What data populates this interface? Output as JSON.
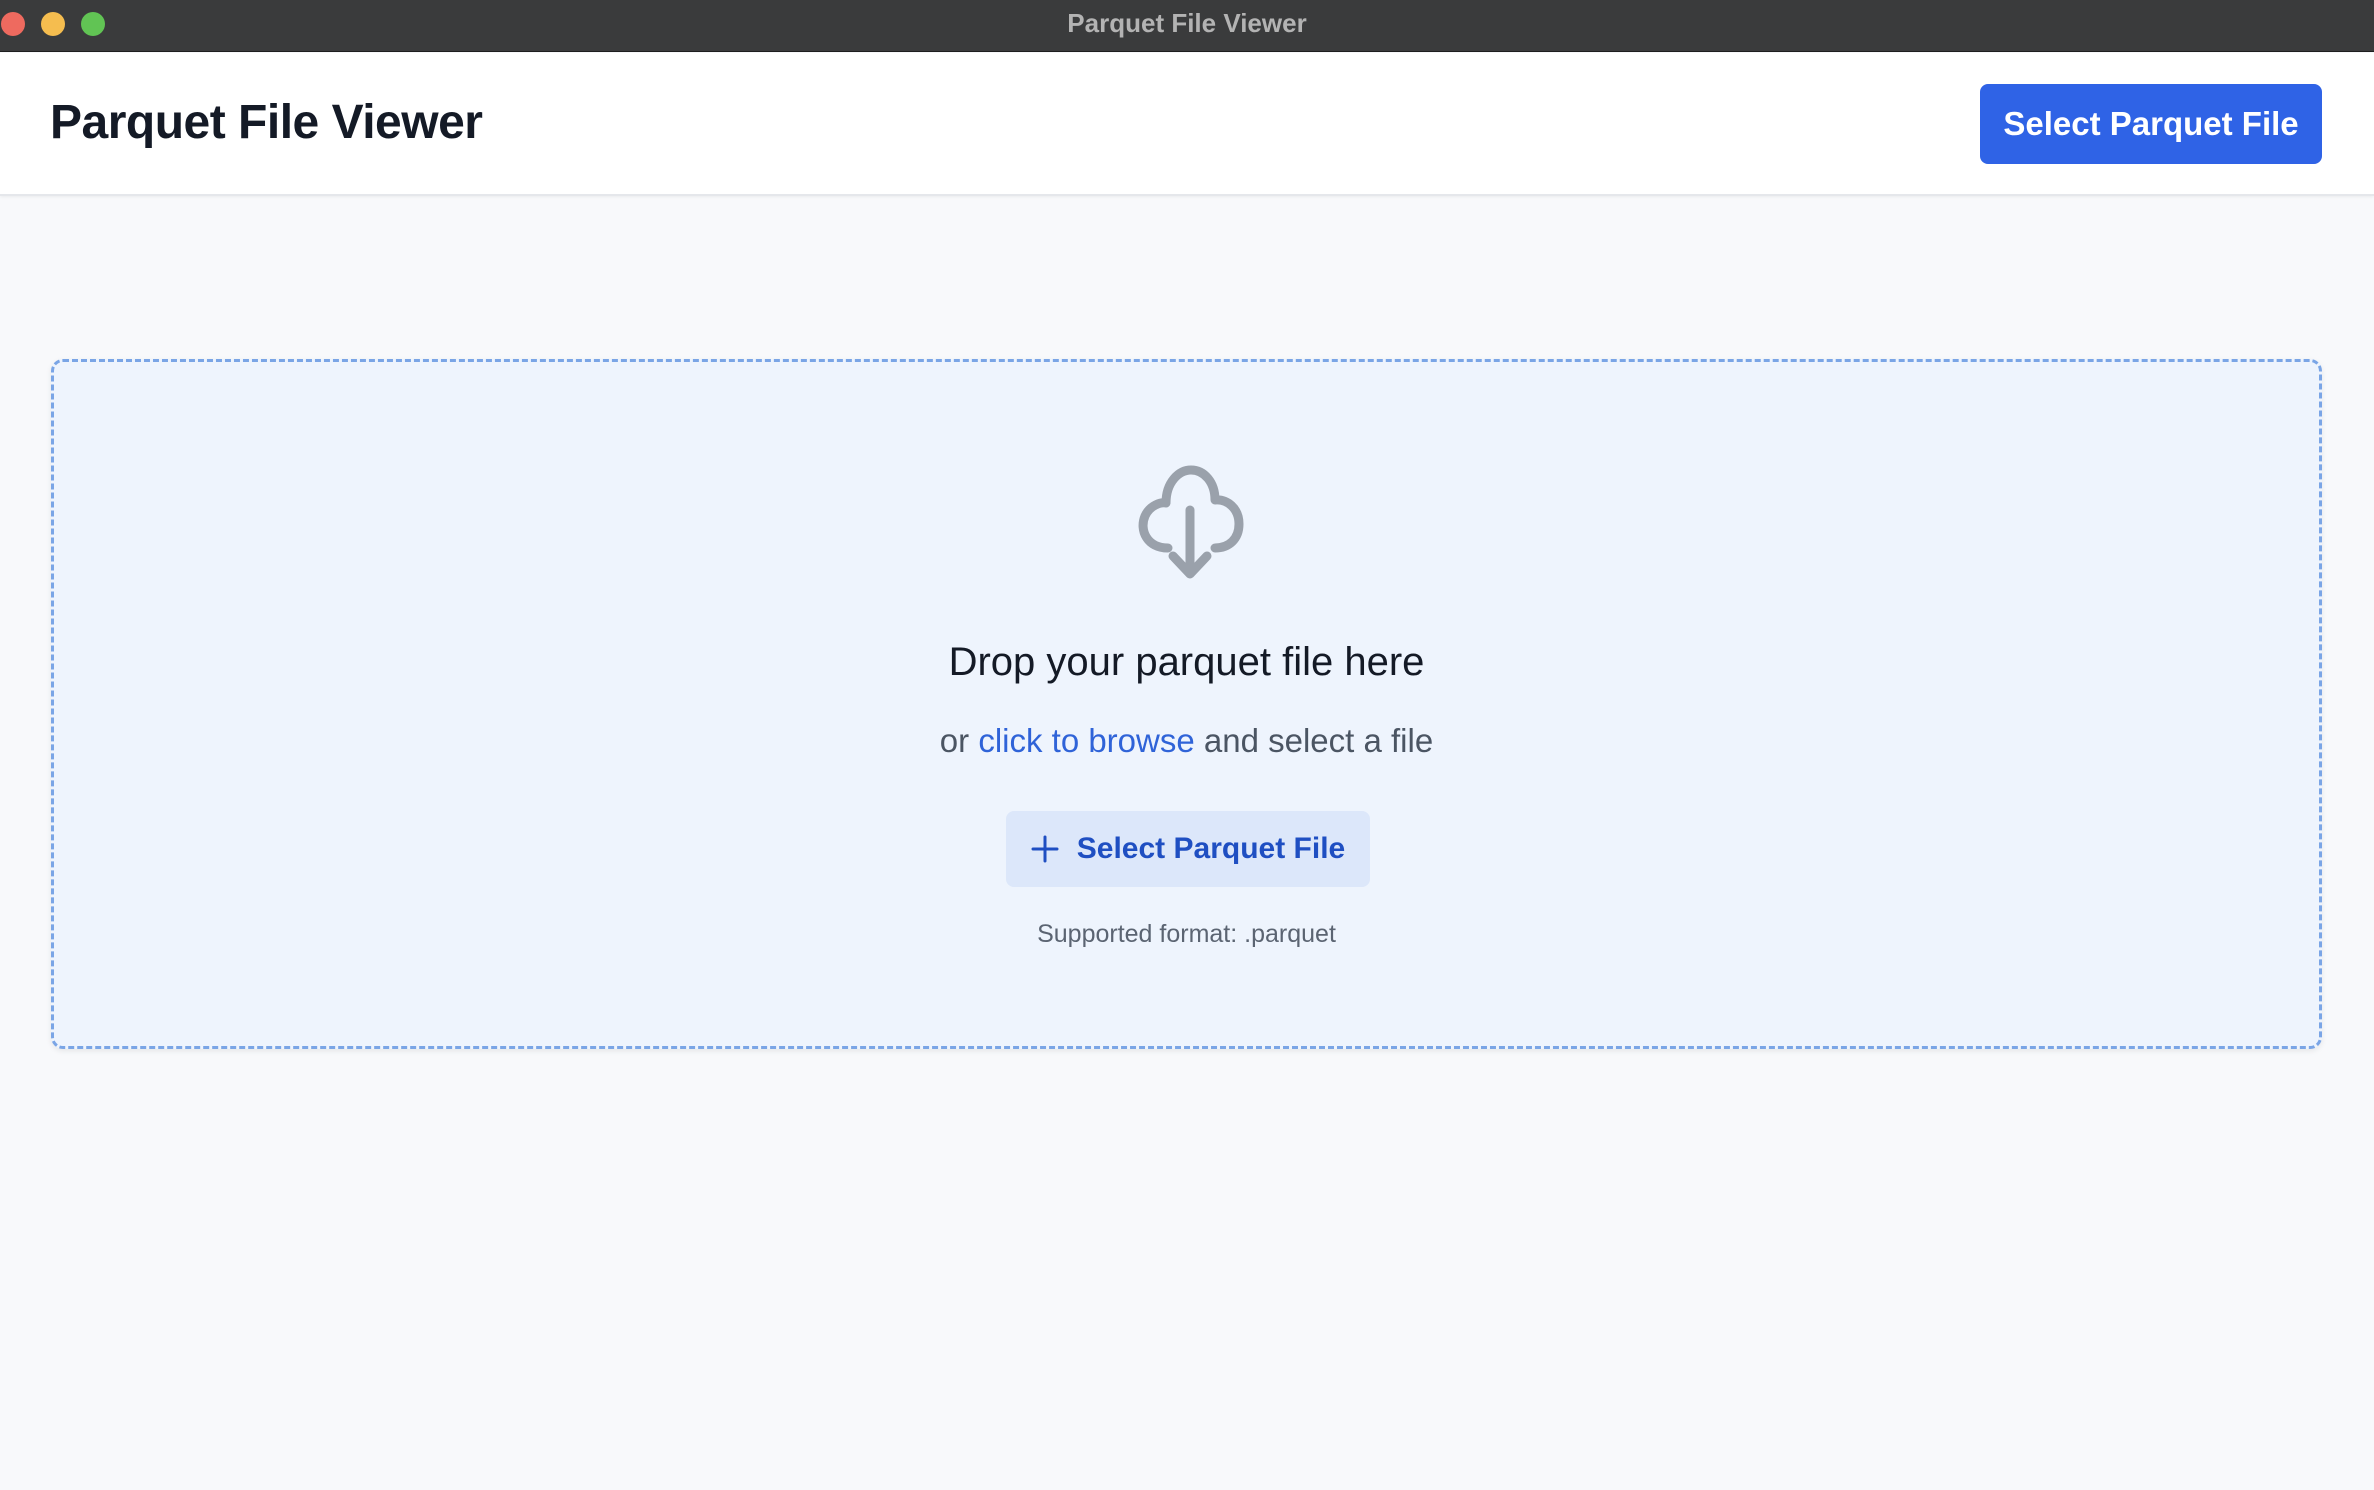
{
  "window": {
    "title": "Parquet File Viewer"
  },
  "header": {
    "title": "Parquet File Viewer",
    "select_button_label": "Select Parquet File"
  },
  "dropzone": {
    "icon": "cloud-download-icon",
    "heading": "Drop your parquet file here",
    "sub_prefix": "or",
    "browse_link": "click to browse",
    "sub_suffix": "and select a file",
    "button_label": "Select Parquet File",
    "button_icon": "plus-icon",
    "supported_text": "Supported format: .parquet"
  },
  "colors": {
    "accent": "#2f63e6",
    "dropzone_bg": "#eef4fd",
    "dropzone_border": "#7aa5e6"
  }
}
